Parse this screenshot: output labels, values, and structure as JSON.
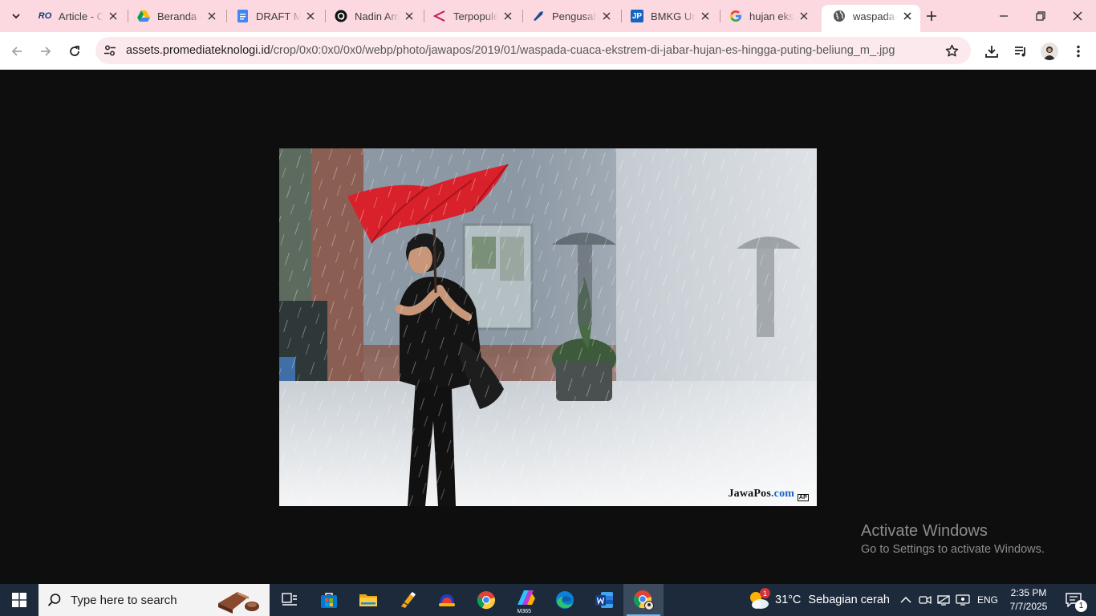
{
  "browser": {
    "tabs": [
      {
        "title": "Article - C",
        "favicon": "ro-icon",
        "active": false
      },
      {
        "title": "Beranda -",
        "favicon": "drive-icon",
        "active": false
      },
      {
        "title": "DRAFT M",
        "favicon": "docs-icon",
        "active": false
      },
      {
        "title": "Nadin Am",
        "favicon": "threads-icon",
        "active": false
      },
      {
        "title": "Terpopule",
        "favicon": "pointer-icon",
        "active": false
      },
      {
        "title": "Pengusah",
        "favicon": "feather-icon",
        "active": false
      },
      {
        "title": "BMKG Un",
        "favicon": "jp-icon",
        "active": false
      },
      {
        "title": "hujan eks",
        "favicon": "google-icon",
        "active": false
      },
      {
        "title": "waspada-",
        "favicon": "globe-icon",
        "active": true
      }
    ],
    "favicon_text": {
      "ro": "RO",
      "jp": "JP"
    },
    "url_host": "assets.promediateknologi.id",
    "url_path": "/crop/0x0:0x0/0x0/webp/photo/jawapos/2019/01/waspada-cuaca-ekstrem-di-jabar-hujan-es-hingga-puting-beliung_m_.jpg",
    "accent": "#fcd9e0"
  },
  "image": {
    "watermark_main": "JawaPos",
    "watermark_dot": ".com",
    "watermark_corner": "AP"
  },
  "activation": {
    "line1": "Activate Windows",
    "line2": "Go to Settings to activate Windows."
  },
  "taskbar": {
    "search_placeholder": "Type here to search",
    "apps": [
      "task-view",
      "microsoft-store",
      "file-explorer",
      "app-pen",
      "app-blue",
      "chrome",
      "m365",
      "edge",
      "word",
      "chrome-active"
    ],
    "m365_label": "M365",
    "weather_temp": "31°C",
    "weather_desc": "Sebagian cerah",
    "weather_badge": "1",
    "language": "ENG",
    "time": "2:35 PM",
    "date": "7/7/2025",
    "notification_count": "1",
    "bg_color": "#1c2a3c"
  }
}
